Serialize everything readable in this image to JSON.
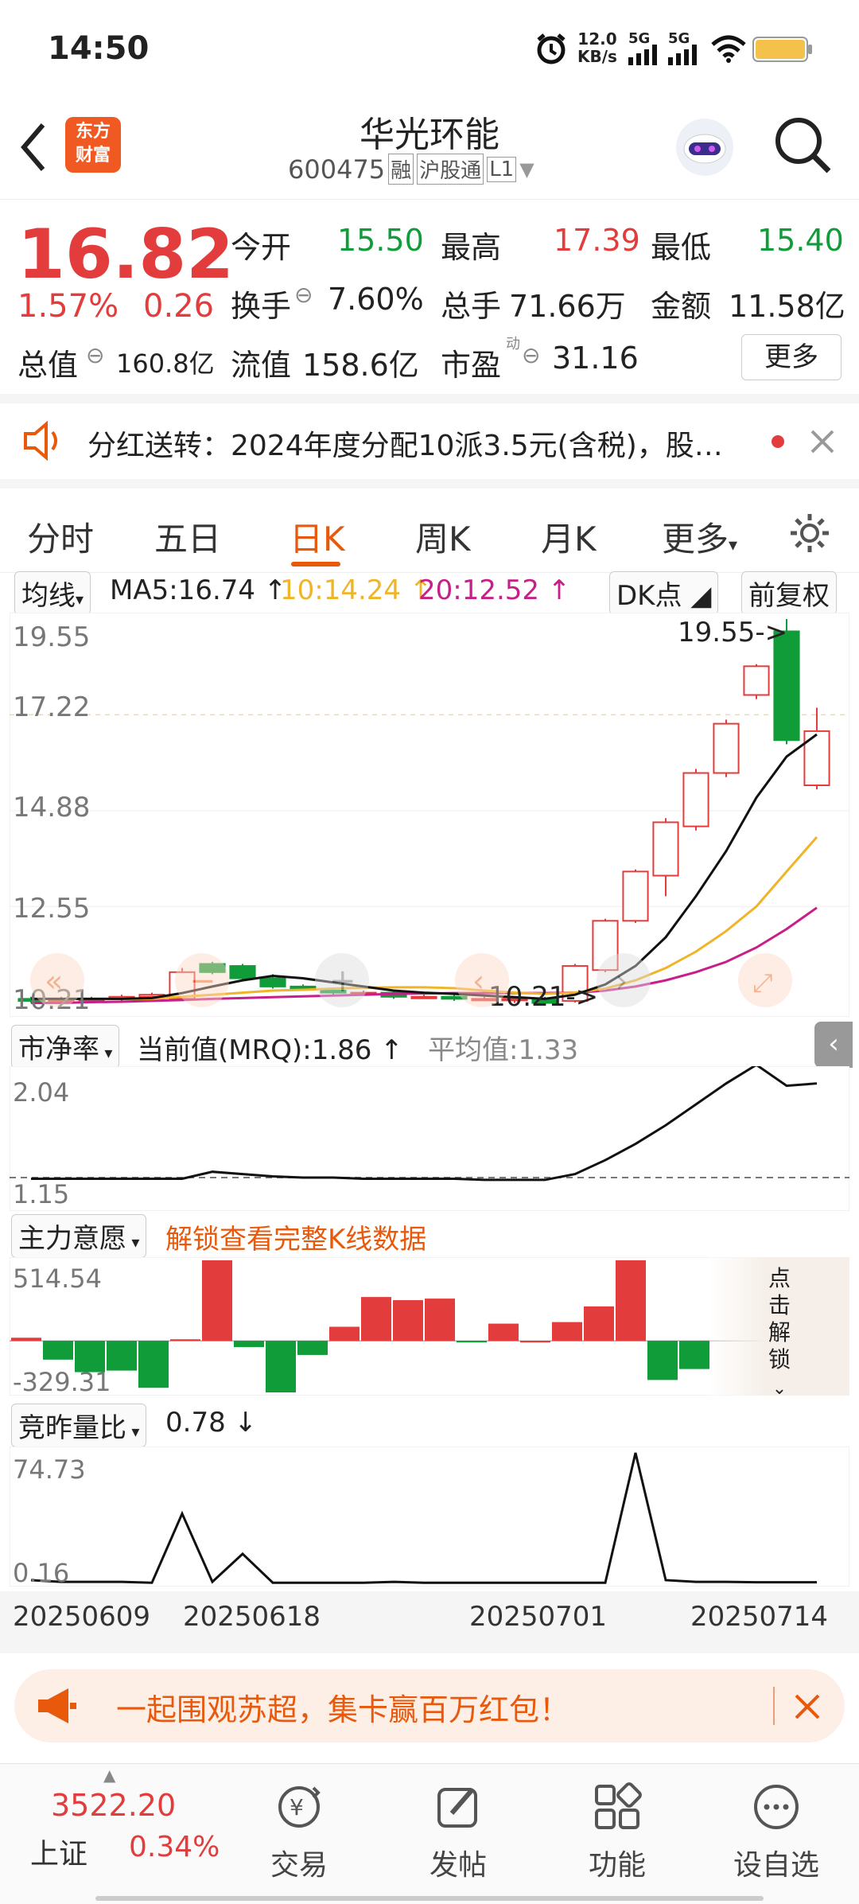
{
  "status": {
    "time": "14:50",
    "net_speed_top": "12.0",
    "net_speed_bottom": "KB/s",
    "sim1": "5G",
    "sim2": "5G"
  },
  "header": {
    "app_logo_line1": "东方",
    "app_logo_line2": "财富",
    "title": "华光环能",
    "code": "600475",
    "badge1": "融",
    "badge2": "沪股通",
    "badge3": "L1"
  },
  "quote": {
    "price": "16.82",
    "change_pct": "1.57%",
    "change": "0.26",
    "open_label": "今开",
    "open": "15.50",
    "high_label": "最高",
    "high": "17.39",
    "low_label": "最低",
    "low": "15.40",
    "turnover_label": "换手",
    "turnover": "7.60%",
    "volume_label": "总手",
    "volume": "71.66万",
    "amount_label": "金额",
    "amount": "11.58亿",
    "mktcap_label": "总值",
    "mktcap": "160.8亿",
    "float_label": "流值",
    "float": "158.6亿",
    "pe_label": "市盈",
    "pe_sup": "动",
    "pe": "31.16",
    "more": "更多"
  },
  "notice": {
    "text": "分红送转：2024年度分配10派3.5元(含税)，股…"
  },
  "tabs": [
    "分时",
    "五日",
    "日K",
    "周K",
    "月K",
    "更多"
  ],
  "kline": {
    "indicator": "均线",
    "ma5": "MA5:16.74",
    "ma10": "10:14.24",
    "ma20": "20:12.52",
    "dk": "DK点",
    "adjust": "前复权",
    "yticks": [
      "19.55",
      "17.22",
      "14.88",
      "12.55",
      "10.21"
    ],
    "high_marker": "19.55->",
    "low_marker": "10.21->"
  },
  "pb": {
    "indicator": "市净率",
    "current": "当前值(MRQ):1.86",
    "avg": "平均值:1.33",
    "top": "2.04",
    "bottom": "1.15"
  },
  "flow": {
    "indicator": "主力意愿",
    "unlock": "解锁查看完整K线数据",
    "top": "514.54",
    "bottom": "-329.31",
    "unlock_side": [
      "点",
      "击",
      "解",
      "锁"
    ]
  },
  "volratio": {
    "indicator": "竞昨量比",
    "value": "0.78",
    "top": "74.73",
    "bottom": "0.16"
  },
  "dates": [
    "20250609",
    "20250618",
    "20250701",
    "20250714"
  ],
  "promo": {
    "text": "一起围观苏超，集卡赢百万红包！"
  },
  "nav": {
    "index_value": "3522.20",
    "index_name": "上证",
    "index_change": "0.34%",
    "trade": "交易",
    "post": "发帖",
    "func": "功能",
    "watch": "设自选"
  },
  "colors": {
    "up": "#e23c3c",
    "down": "#119c3a",
    "accent": "#e8590c",
    "ma10": "#f0b429",
    "ma20": "#c81e8a"
  },
  "chart_data": [
    {
      "type": "candlestick",
      "title": "日K",
      "ylim": [
        10.21,
        19.55
      ],
      "candles": [
        {
          "o": 10.3,
          "c": 10.25,
          "h": 10.35,
          "l": 10.2
        },
        {
          "o": 10.25,
          "c": 10.3,
          "h": 10.35,
          "l": 10.2
        },
        {
          "o": 10.3,
          "c": 10.3,
          "h": 10.35,
          "l": 10.25
        },
        {
          "o": 10.3,
          "c": 10.35,
          "h": 10.4,
          "l": 10.2
        },
        {
          "o": 10.35,
          "c": 10.4,
          "h": 10.45,
          "l": 10.3
        },
        {
          "o": 10.3,
          "c": 10.95,
          "h": 11.05,
          "l": 10.25
        },
        {
          "o": 11.15,
          "c": 10.95,
          "h": 11.2,
          "l": 10.9
        },
        {
          "o": 11.1,
          "c": 10.8,
          "h": 11.15,
          "l": 10.75
        },
        {
          "o": 10.8,
          "c": 10.6,
          "h": 10.9,
          "l": 10.55
        },
        {
          "o": 10.6,
          "c": 10.55,
          "h": 10.65,
          "l": 10.5
        },
        {
          "o": 10.5,
          "c": 10.45,
          "h": 10.55,
          "l": 10.4
        },
        {
          "o": 10.45,
          "c": 10.45,
          "h": 10.5,
          "l": 10.4
        },
        {
          "o": 10.45,
          "c": 10.35,
          "h": 10.5,
          "l": 10.3
        },
        {
          "o": 10.35,
          "c": 10.35,
          "h": 10.4,
          "l": 10.3
        },
        {
          "o": 10.35,
          "c": 10.3,
          "h": 10.4,
          "l": 10.25
        },
        {
          "o": 10.3,
          "c": 10.3,
          "h": 10.35,
          "l": 10.25
        },
        {
          "o": 10.3,
          "c": 10.3,
          "h": 10.35,
          "l": 10.2
        },
        {
          "o": 10.3,
          "c": 10.2,
          "h": 10.35,
          "l": 10.15
        },
        {
          "o": 10.25,
          "c": 11.1,
          "h": 11.15,
          "l": 10.21
        },
        {
          "o": 11.0,
          "c": 12.2,
          "h": 12.25,
          "l": 10.95
        },
        {
          "o": 12.2,
          "c": 13.4,
          "h": 13.45,
          "l": 12.15
        },
        {
          "o": 13.3,
          "c": 14.6,
          "h": 14.7,
          "l": 12.8
        },
        {
          "o": 14.5,
          "c": 15.8,
          "h": 15.9,
          "l": 14.4
        },
        {
          "o": 15.8,
          "c": 17.0,
          "h": 17.1,
          "l": 15.7
        },
        {
          "o": 17.7,
          "c": 18.4,
          "h": 18.45,
          "l": 17.6
        },
        {
          "o": 19.25,
          "c": 16.6,
          "h": 19.55,
          "l": 16.5
        },
        {
          "o": 15.5,
          "c": 16.82,
          "h": 17.39,
          "l": 15.4
        }
      ],
      "ma5": [
        10.3,
        10.3,
        10.3,
        10.3,
        10.32,
        10.44,
        10.6,
        10.75,
        10.86,
        10.8,
        10.7,
        10.6,
        10.5,
        10.45,
        10.42,
        10.38,
        10.34,
        10.3,
        10.4,
        10.65,
        11.1,
        11.8,
        12.8,
        13.9,
        15.2,
        16.2,
        16.74
      ],
      "ma10": [
        10.3,
        10.3,
        10.3,
        10.3,
        10.3,
        10.35,
        10.4,
        10.45,
        10.5,
        10.52,
        10.55,
        10.57,
        10.58,
        10.58,
        10.56,
        10.5,
        10.45,
        10.42,
        10.45,
        10.55,
        10.75,
        11.05,
        11.45,
        11.95,
        12.55,
        13.4,
        14.24
      ],
      "ma20": [
        10.2,
        10.2,
        10.22,
        10.23,
        10.25,
        10.27,
        10.3,
        10.32,
        10.34,
        10.36,
        10.38,
        10.4,
        10.42,
        10.43,
        10.44,
        10.44,
        10.44,
        10.44,
        10.45,
        10.5,
        10.6,
        10.75,
        10.95,
        11.2,
        11.55,
        12.0,
        12.52
      ]
    },
    {
      "type": "line",
      "title": "市净率",
      "ylim": [
        1.15,
        2.04
      ],
      "values": [
        1.14,
        1.14,
        1.14,
        1.14,
        1.14,
        1.14,
        1.2,
        1.18,
        1.16,
        1.15,
        1.15,
        1.14,
        1.14,
        1.14,
        1.14,
        1.13,
        1.13,
        1.13,
        1.18,
        1.3,
        1.44,
        1.6,
        1.78,
        1.96,
        2.12,
        1.94,
        1.96
      ]
    },
    {
      "type": "bar",
      "title": "主力意愿",
      "ylim": [
        -329.31,
        514.54
      ],
      "values": [
        20,
        -120,
        -200,
        -190,
        -300,
        10,
        514.54,
        -40,
        -329.31,
        -90,
        90,
        280,
        260,
        270,
        -10,
        110,
        0,
        120,
        220,
        514.54,
        -250,
        -180
      ]
    },
    {
      "type": "line",
      "title": "竞昨量比",
      "ylim": [
        0.16,
        74.73
      ],
      "values": [
        2,
        1,
        1,
        1,
        0.5,
        40,
        1,
        17,
        0.5,
        0.5,
        0.5,
        0.5,
        1,
        0.5,
        0.5,
        0.5,
        0.5,
        0.5,
        0.5,
        0.5,
        74.73,
        2,
        1,
        1,
        0.78,
        0.78,
        0.78
      ]
    }
  ]
}
